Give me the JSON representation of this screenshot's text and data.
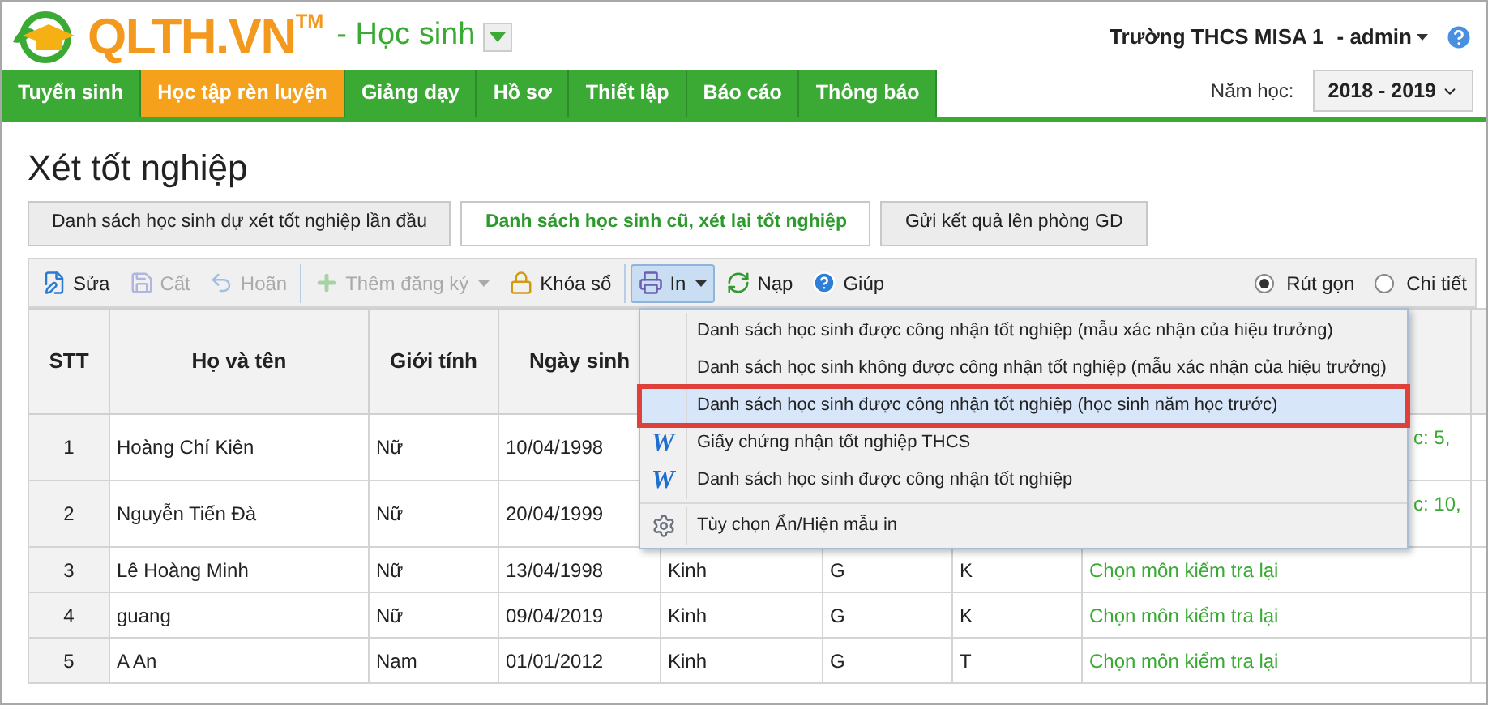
{
  "header": {
    "brand": "QLTH.VN",
    "trademark": "TM",
    "module": "- Học sinh",
    "school": "Trường THCS MISA 1",
    "user": "- admin"
  },
  "nav": [
    {
      "label": "Tuyển sinh",
      "selected": false
    },
    {
      "label": "Học tập rèn luyện",
      "selected": true
    },
    {
      "label": "Giảng dạy",
      "selected": false
    },
    {
      "label": "Hồ sơ",
      "selected": false
    },
    {
      "label": "Thiết lập",
      "selected": false
    },
    {
      "label": "Báo cáo",
      "selected": false
    },
    {
      "label": "Thông báo",
      "selected": false
    }
  ],
  "year": {
    "label": "Năm học:",
    "value": "2018 - 2019"
  },
  "page_title": "Xét tốt nghiệp",
  "tabs": [
    {
      "label": "Danh sách học sinh dự xét tốt nghiệp lần đầu",
      "selected": false
    },
    {
      "label": "Danh sách học sinh cũ, xét lại tốt nghiệp",
      "selected": true
    },
    {
      "label": "Gửi kết quả lên phòng GD",
      "selected": false
    }
  ],
  "toolbar": {
    "groups": [
      [
        {
          "kind": "edit",
          "label": "Sửa",
          "disabled": false
        },
        {
          "kind": "save",
          "label": "Cất",
          "disabled": true
        },
        {
          "kind": "undo",
          "label": "Hoãn",
          "disabled": true
        }
      ],
      [
        {
          "kind": "add",
          "label": "Thêm đăng ký",
          "disabled": true,
          "dropdown": true
        },
        {
          "kind": "lock",
          "label": "Khóa sổ",
          "disabled": false
        }
      ],
      [
        {
          "kind": "print",
          "label": "In",
          "disabled": false,
          "dropdown": true,
          "pressed": true
        },
        {
          "kind": "reload",
          "label": "Nạp",
          "disabled": false
        },
        {
          "kind": "help",
          "label": "Giúp",
          "disabled": false
        }
      ]
    ],
    "view": [
      {
        "label": "Rút gọn",
        "selected": true
      },
      {
        "label": "Chi tiết",
        "selected": false
      }
    ]
  },
  "table": {
    "columns": [
      "STT",
      "Họ và tên",
      "Giới tính",
      "Ngày sinh"
    ],
    "rows": [
      {
        "stt": "1",
        "name": "Hoàng Chí Kiên",
        "gender": "Nữ",
        "dob": "10/04/1998",
        "column_8": "c: 5,"
      },
      {
        "stt": "2",
        "name": "Nguyễn Tiến Đà",
        "gender": "Nữ",
        "dob": "20/04/1999",
        "column_8": "c: 10,"
      },
      {
        "stt": "3",
        "name": "Lê Hoàng Minh",
        "gender": "Nữ",
        "dob": "13/04/1998",
        "column_5": "Kinh",
        "column_6": "G",
        "column_7": "K",
        "column_8": "Chọn môn kiểm tra lại"
      },
      {
        "stt": "4",
        "name": "guang",
        "gender": "Nữ",
        "dob": "09/04/2019",
        "column_5": "Kinh",
        "column_6": "G",
        "column_7": "K",
        "column_8": "Chọn môn kiểm tra lại"
      },
      {
        "stt": "5",
        "name": "A An",
        "gender": "Nam",
        "dob": "01/01/2012",
        "column_5": "Kinh",
        "column_6": "G",
        "column_7": "T",
        "column_8": "Chọn môn kiểm tra lại"
      }
    ]
  },
  "print_menu": [
    {
      "kind": "plain",
      "label": "Danh sách học sinh được công nhận tốt nghiệp (mẫu xác nhận của hiệu trưởng)",
      "selected": false
    },
    {
      "kind": "plain",
      "label": "Danh sách học sinh không được công nhận tốt nghiệp (mẫu xác nhận của hiệu trưởng)",
      "selected": false
    },
    {
      "kind": "plain",
      "label": "Danh sách học sinh được công nhận tốt nghiệp (học sinh năm học trước)",
      "selected": true
    },
    {
      "kind": "word",
      "icon_text": "W",
      "label": "Giấy chứng nhận tốt nghiệp THCS",
      "selected": false
    },
    {
      "kind": "word",
      "icon_text": "W",
      "label": "Danh sách học sinh được công nhận tốt nghiệp",
      "selected": false
    },
    {
      "kind": "settings",
      "label": "Tùy chọn Ẩn/Hiện mẫu in",
      "selected": false
    }
  ]
}
